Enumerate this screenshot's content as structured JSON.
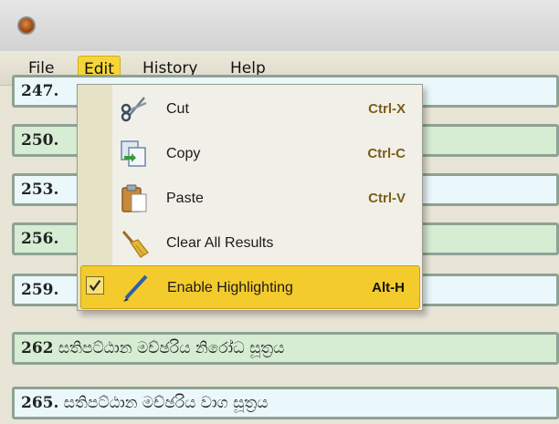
{
  "menubar": {
    "items": [
      {
        "label": "File",
        "active": false
      },
      {
        "label": "Edit",
        "active": true
      },
      {
        "label": "History",
        "active": false
      },
      {
        "label": "Help",
        "active": false
      }
    ]
  },
  "results": {
    "rows": [
      {
        "num": "247.",
        "text": "",
        "style": "blue"
      },
      {
        "num": "250.",
        "text": "",
        "style": "green"
      },
      {
        "num": "253.",
        "text": "",
        "style": "blue"
      },
      {
        "num": "256.",
        "text": "",
        "style": "green"
      },
      {
        "num": "259.",
        "text": "",
        "style": "blue"
      },
      {
        "num": "262",
        "text": " සතිපට්ඨාන මච්ඡරිය නිරෝධ සූත්‍රය",
        "style": "green"
      },
      {
        "num": "265.",
        "text": " සතිපට්ඨාන මච්ඡරිය වාග සූත්‍රය",
        "style": "blue"
      }
    ]
  },
  "edit_menu": {
    "items": [
      {
        "label": "Cut",
        "accel": "Ctrl-X",
        "icon": "scissors-icon"
      },
      {
        "label": "Copy",
        "accel": "Ctrl-C",
        "icon": "copy-icon"
      },
      {
        "label": "Paste",
        "accel": "Ctrl-V",
        "icon": "paste-icon"
      },
      {
        "label": "Clear All Results",
        "accel": "",
        "icon": "broom-icon"
      },
      {
        "label": "Enable Highlighting",
        "accel": "Alt-H",
        "icon": "pen-icon",
        "checked": true,
        "selected": true
      }
    ]
  },
  "colors": {
    "menu_highlight": "#f4cb2c",
    "row_blue": "#eaf7fb",
    "row_green": "#d6ecd3",
    "accelerator": "#7c5d18"
  }
}
